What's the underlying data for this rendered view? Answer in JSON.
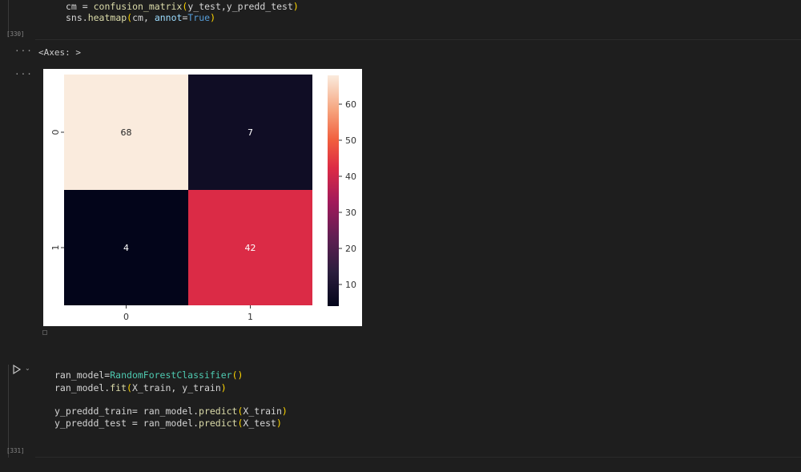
{
  "cell_1": {
    "code_lines": [
      [
        "cm = ",
        "confusion_matrix",
        "(",
        "y_test,y_predd_test",
        ")"
      ],
      [
        "sns.",
        "heatmap",
        "(",
        "cm, ",
        "annot",
        "=",
        "True",
        ")"
      ]
    ],
    "exec_count": "[330]"
  },
  "output": {
    "dots_1": "···",
    "dots_2": "···",
    "text": "<Axes: >"
  },
  "chart_data": {
    "type": "heatmap",
    "rows": [
      "0",
      "1"
    ],
    "cols": [
      "0",
      "1"
    ],
    "values": [
      [
        68,
        7
      ],
      [
        4,
        42
      ]
    ],
    "colorbar_ticks": [
      10,
      20,
      30,
      40,
      50,
      60
    ],
    "vmin": 4,
    "vmax": 68,
    "annot": true
  },
  "cell_2": {
    "code_lines": [
      [
        "ran_model=",
        "RandomForestClassifier",
        "(",
        ")"
      ],
      [
        "ran_model.",
        "fit",
        "(",
        "X_train, y_train",
        ")"
      ],
      [
        ""
      ],
      [
        "y_preddd_train= ran_model.",
        "predict",
        "(",
        "X_train",
        ")"
      ],
      [
        "y_preddd_test = ran_model.",
        "predict",
        "(",
        "X_test",
        ")"
      ]
    ],
    "exec_count": "[331]",
    "chevron": "⌄"
  }
}
